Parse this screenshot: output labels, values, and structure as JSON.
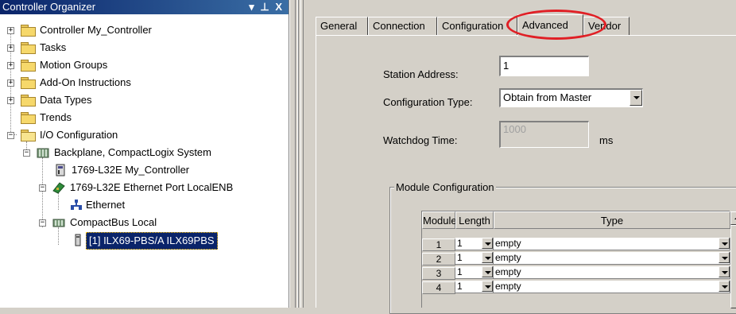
{
  "organizer": {
    "title": "Controller Organizer",
    "title_controls": "▾ ⊥ X",
    "tree": {
      "controller": "Controller My_Controller",
      "tasks": "Tasks",
      "motion_groups": "Motion Groups",
      "addon_instructions": "Add-On Instructions",
      "data_types": "Data Types",
      "trends": "Trends",
      "io_configuration": "I/O Configuration",
      "backplane": "Backplane, CompactLogix System",
      "controller_module": "1769-L32E My_Controller",
      "ethernet_port": "1769-L32E Ethernet Port LocalENB",
      "ethernet": "Ethernet",
      "compactbus": "CompactBus Local",
      "selected_module": "[1] ILX69-PBS/A ILX69PBS"
    }
  },
  "tabs": {
    "general": "General",
    "connection": "Connection",
    "configuration": "Configuration",
    "advanced": "Advanced",
    "vendor": "Vendor",
    "active": "advanced"
  },
  "form": {
    "station_address_label": "Station Address:",
    "station_address_value": "1",
    "configuration_type_label": "Configuration Type:",
    "configuration_type_value": "Obtain from Master",
    "watchdog_label": "Watchdog Time:",
    "watchdog_value": "1000",
    "watchdog_unit": "ms"
  },
  "module_config": {
    "legend": "Module Configuration",
    "columns": [
      "Module",
      "Length",
      "Type"
    ],
    "rows": [
      {
        "module": "1",
        "length": "1",
        "type": "empty"
      },
      {
        "module": "2",
        "length": "1",
        "type": "empty"
      },
      {
        "module": "3",
        "length": "1",
        "type": "empty"
      },
      {
        "module": "4",
        "length": "1",
        "type": "empty"
      }
    ]
  },
  "colors": {
    "title_bar": "#0a246a",
    "window_face": "#d4d0c8",
    "highlight_circle": "#e01f25"
  }
}
